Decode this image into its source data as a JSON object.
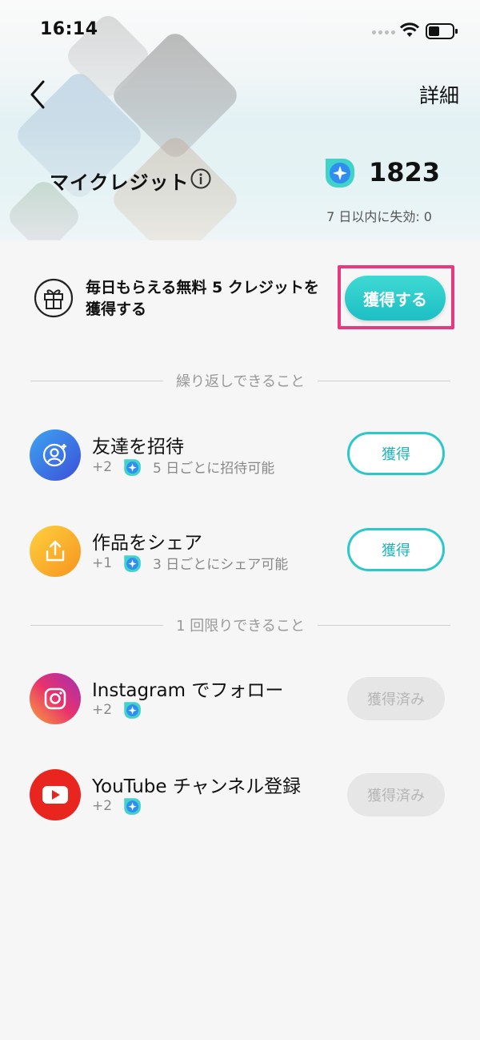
{
  "status_bar": {
    "time": "16:14"
  },
  "header": {
    "back_icon": "chevron-left-icon",
    "detail_label": "詳細",
    "title": "マイクレジット",
    "credit_count": "1823",
    "expire_text": "7 日以内に失効: 0"
  },
  "daily": {
    "text": "毎日もらえる無料 5 クレジットを獲得する",
    "button_label": "獲得する",
    "highlight_color": "#e8387f"
  },
  "sections": {
    "repeat_label": "繰り返しできること",
    "once_label": "1 回限りできること"
  },
  "tasks": [
    {
      "title": "友達を招待",
      "plus": "+2",
      "desc": "5 日ごとに招待可能",
      "button": "獲得",
      "icon": "add-friend-icon",
      "done": false
    },
    {
      "title": "作品をシェア",
      "plus": "+1",
      "desc": "3 日ごとにシェア可能",
      "button": "獲得",
      "icon": "share-icon",
      "done": false
    },
    {
      "title": "Instagram でフォロー",
      "plus": "+2",
      "desc": "",
      "button": "獲得済み",
      "icon": "instagram-icon",
      "done": true
    },
    {
      "title": "YouTube チャンネル登録",
      "plus": "+2",
      "desc": "",
      "button": "獲得済み",
      "icon": "youtube-icon",
      "done": true
    }
  ],
  "colors": {
    "accent": "#2cc7cb",
    "instagram": "#d6297a",
    "youtube": "#e8261f",
    "invite": "#3b6fe0",
    "share": "#fbab1e"
  }
}
